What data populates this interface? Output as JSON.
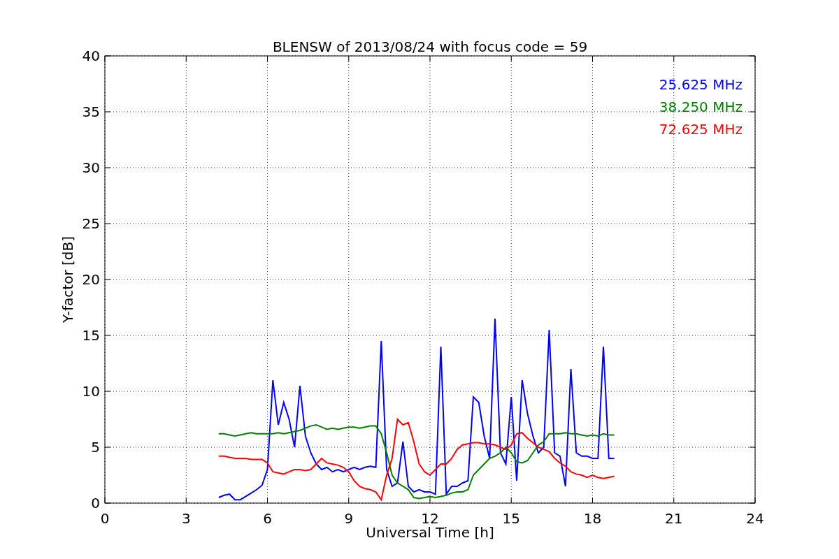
{
  "figure": {
    "chart_data": {
      "type": "line",
      "title": "BLENSW of 2013/08/24 with focus code = 59",
      "xlabel": "Universal Time [h]",
      "ylabel": "Y-factor [dB]",
      "x": [
        4.2,
        4.4,
        4.6,
        4.8,
        5.0,
        5.2,
        5.4,
        5.6,
        5.8,
        6.0,
        6.2,
        6.4,
        6.6,
        6.8,
        7.0,
        7.2,
        7.4,
        7.6,
        7.8,
        8.0,
        8.2,
        8.4,
        8.6,
        8.8,
        9.0,
        9.2,
        9.4,
        9.6,
        9.8,
        10.0,
        10.2,
        10.4,
        10.6,
        10.8,
        11.0,
        11.2,
        11.4,
        11.6,
        11.8,
        12.0,
        12.2,
        12.4,
        12.6,
        12.8,
        13.0,
        13.2,
        13.4,
        13.6,
        13.8,
        14.0,
        14.2,
        14.4,
        14.6,
        14.8,
        15.0,
        15.2,
        15.4,
        15.6,
        15.8,
        16.0,
        16.2,
        16.4,
        16.6,
        16.8,
        17.0,
        17.2,
        17.4,
        17.6,
        17.8,
        18.0,
        18.2,
        18.4,
        18.6,
        18.8
      ],
      "series": [
        {
          "name": "25.625 MHz",
          "color": "#0000ff",
          "values": [
            0.5,
            0.7,
            0.8,
            0.3,
            0.3,
            0.6,
            0.9,
            1.2,
            1.6,
            3,
            11,
            7,
            9,
            7.5,
            5,
            10.5,
            6,
            4.5,
            3.5,
            3,
            3.2,
            2.8,
            3,
            2.8,
            3,
            3.2,
            3,
            3.2,
            3.3,
            3.2,
            14.5,
            3,
            1.5,
            1.8,
            5.5,
            1.5,
            1,
            1.2,
            1,
            1,
            0.8,
            14,
            0.8,
            1.5,
            1.5,
            1.8,
            2,
            9.5,
            9,
            6,
            4,
            16.5,
            4.5,
            3.5,
            9.5,
            2,
            11,
            8,
            6,
            4.5,
            5,
            15.5,
            4.5,
            4.2,
            1.5,
            12,
            4.5,
            4.2,
            4.2,
            4,
            4,
            14,
            4,
            4
          ]
        },
        {
          "name": "38.250 MHz",
          "color": "#008000",
          "values": [
            6.2,
            6.2,
            6.1,
            6.0,
            6.1,
            6.2,
            6.3,
            6.2,
            6.2,
            6.2,
            6.2,
            6.3,
            6.2,
            6.3,
            6.4,
            6.5,
            6.7,
            6.9,
            7.0,
            6.8,
            6.6,
            6.7,
            6.6,
            6.7,
            6.8,
            6.8,
            6.7,
            6.8,
            6.9,
            6.9,
            6.2,
            4.5,
            2.5,
            1.8,
            1.5,
            1.2,
            0.5,
            0.4,
            0.5,
            0.6,
            0.5,
            0.6,
            0.7,
            0.9,
            1.0,
            1.0,
            1.2,
            2.5,
            3,
            3.5,
            4,
            4.2,
            4.5,
            5,
            4.5,
            3.7,
            3.6,
            3.8,
            4.5,
            5.2,
            5.5,
            6.2,
            6.2,
            6.2,
            6.3,
            6.2,
            6.2,
            6.1,
            6.0,
            6.1,
            6.0,
            6.2,
            6.1,
            6.1
          ]
        },
        {
          "name": "72.625 MHz",
          "color": "#ff0000",
          "values": [
            4.2,
            4.2,
            4.1,
            4.0,
            4.0,
            4.0,
            3.9,
            3.9,
            3.9,
            3.6,
            2.8,
            2.7,
            2.6,
            2.8,
            3.0,
            3.0,
            2.9,
            3.0,
            3.5,
            4.0,
            3.6,
            3.5,
            3.4,
            3.2,
            2.8,
            2.0,
            1.5,
            1.3,
            1.2,
            1.0,
            0.3,
            2.5,
            4,
            7.5,
            7.0,
            7.2,
            5.5,
            3.5,
            2.8,
            2.5,
            3.0,
            3.5,
            3.5,
            4.0,
            4.8,
            5.2,
            5.3,
            5.4,
            5.4,
            5.3,
            5.3,
            5.2,
            5.0,
            4.8,
            5.2,
            6.2,
            6.3,
            5.8,
            5.4,
            5.0,
            4.8,
            4.6,
            4.0,
            3.6,
            3.3,
            2.8,
            2.6,
            2.5,
            2.3,
            2.5,
            2.3,
            2.2,
            2.3,
            2.4
          ]
        }
      ],
      "grid": true,
      "xlim": [
        0,
        24
      ],
      "ylim": [
        0,
        40
      ],
      "xticks": [
        0,
        3,
        6,
        9,
        12,
        15,
        18,
        21,
        24
      ],
      "yticks": [
        0,
        5,
        10,
        15,
        20,
        25,
        30,
        35,
        40
      ]
    }
  }
}
